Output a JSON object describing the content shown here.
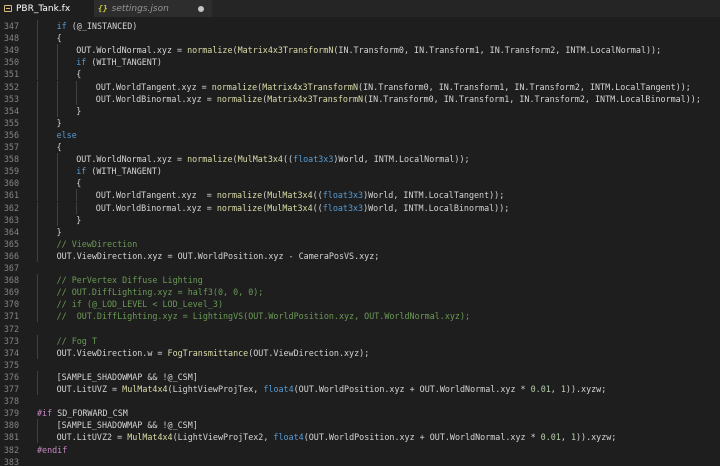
{
  "tabs": [
    {
      "label": "PBR_Tank.fx",
      "icon": "fx-file-icon",
      "active": true,
      "dirty": false
    },
    {
      "label": "settings.json",
      "icon": "json-file-icon",
      "active": false,
      "dirty": true
    }
  ],
  "lines": [
    {
      "n": "347",
      "indent": 1,
      "tokens": [
        [
          "kw",
          "if"
        ],
        [
          "id",
          " (@_INSTANCED)"
        ]
      ]
    },
    {
      "n": "348",
      "indent": 1,
      "tokens": [
        [
          "id",
          "{"
        ]
      ]
    },
    {
      "n": "349",
      "indent": 2,
      "tokens": [
        [
          "id",
          "OUT.WorldNormal.xyz = "
        ],
        [
          "fn",
          "normalize"
        ],
        [
          "id",
          "("
        ],
        [
          "fn",
          "Matrix4x3TransformN"
        ],
        [
          "id",
          "(IN.Transform0, IN.Transform1, IN.Transform2, INTM.LocalNormal));"
        ]
      ]
    },
    {
      "n": "350",
      "indent": 2,
      "tokens": [
        [
          "kw",
          "if"
        ],
        [
          "id",
          " (WITH_TANGENT)"
        ]
      ]
    },
    {
      "n": "351",
      "indent": 2,
      "tokens": [
        [
          "id",
          "{"
        ]
      ]
    },
    {
      "n": "352",
      "indent": 3,
      "tokens": [
        [
          "id",
          "OUT.WorldTangent.xyz = "
        ],
        [
          "fn",
          "normalize"
        ],
        [
          "id",
          "("
        ],
        [
          "fn",
          "Matrix4x3TransformN"
        ],
        [
          "id",
          "(IN.Transform0, IN.Transform1, IN.Transform2, INTM.LocalTangent));"
        ]
      ]
    },
    {
      "n": "353",
      "indent": 3,
      "tokens": [
        [
          "id",
          "OUT.WorldBinormal.xyz = "
        ],
        [
          "fn",
          "normalize"
        ],
        [
          "id",
          "("
        ],
        [
          "fn",
          "Matrix4x3TransformN"
        ],
        [
          "id",
          "(IN.Transform0, IN.Transform1, IN.Transform2, INTM.LocalBinormal));"
        ]
      ]
    },
    {
      "n": "354",
      "indent": 2,
      "tokens": [
        [
          "id",
          "}"
        ]
      ]
    },
    {
      "n": "355",
      "indent": 1,
      "tokens": [
        [
          "id",
          "}"
        ]
      ]
    },
    {
      "n": "356",
      "indent": 1,
      "tokens": [
        [
          "kw",
          "else"
        ]
      ]
    },
    {
      "n": "357",
      "indent": 1,
      "tokens": [
        [
          "id",
          "{"
        ]
      ]
    },
    {
      "n": "358",
      "indent": 2,
      "tokens": [
        [
          "id",
          "OUT.WorldNormal.xyz = "
        ],
        [
          "fn",
          "normalize"
        ],
        [
          "id",
          "("
        ],
        [
          "fn",
          "MulMat3x4"
        ],
        [
          "id",
          "(("
        ],
        [
          "ty",
          "float3x3"
        ],
        [
          "id",
          ")World, INTM.LocalNormal));"
        ]
      ]
    },
    {
      "n": "359",
      "indent": 2,
      "tokens": [
        [
          "kw",
          "if"
        ],
        [
          "id",
          " (WITH_TANGENT)"
        ]
      ]
    },
    {
      "n": "360",
      "indent": 2,
      "tokens": [
        [
          "id",
          "{"
        ]
      ]
    },
    {
      "n": "361",
      "indent": 3,
      "tokens": [
        [
          "id",
          "OUT.WorldTangent.xyz  = "
        ],
        [
          "fn",
          "normalize"
        ],
        [
          "id",
          "("
        ],
        [
          "fn",
          "MulMat3x4"
        ],
        [
          "id",
          "(("
        ],
        [
          "ty",
          "float3x3"
        ],
        [
          "id",
          ")World, INTM.LocalTangent));"
        ]
      ]
    },
    {
      "n": "362",
      "indent": 3,
      "tokens": [
        [
          "id",
          "OUT.WorldBinormal.xyz = "
        ],
        [
          "fn",
          "normalize"
        ],
        [
          "id",
          "("
        ],
        [
          "fn",
          "MulMat3x4"
        ],
        [
          "id",
          "(("
        ],
        [
          "ty",
          "float3x3"
        ],
        [
          "id",
          ")World, INTM.LocalBinormal));"
        ]
      ]
    },
    {
      "n": "363",
      "indent": 2,
      "tokens": [
        [
          "id",
          "}"
        ]
      ]
    },
    {
      "n": "364",
      "indent": 1,
      "tokens": [
        [
          "id",
          "}"
        ]
      ]
    },
    {
      "n": "365",
      "indent": 1,
      "tokens": [
        [
          "cm",
          "// ViewDirection"
        ]
      ]
    },
    {
      "n": "366",
      "indent": 1,
      "tokens": [
        [
          "id",
          "OUT.ViewDirection.xyz = OUT.WorldPosition.xyz - CameraPosVS.xyz;"
        ]
      ]
    },
    {
      "n": "367",
      "indent": 0,
      "tokens": []
    },
    {
      "n": "368",
      "indent": 1,
      "tokens": [
        [
          "cm",
          "// PerVertex Diffuse Lighting"
        ]
      ]
    },
    {
      "n": "369",
      "indent": 1,
      "tokens": [
        [
          "cm",
          "// OUT.DiffLighting.xyz = half3(0, 0, 0);"
        ]
      ]
    },
    {
      "n": "370",
      "indent": 1,
      "tokens": [
        [
          "cm",
          "// if (@_LOD_LEVEL < LOD_Level_3)"
        ]
      ]
    },
    {
      "n": "371",
      "indent": 1,
      "tokens": [
        [
          "cm",
          "//  OUT.DiffLighting.xyz = LightingVS(OUT.WorldPosition.xyz, OUT.WorldNormal.xyz);"
        ]
      ]
    },
    {
      "n": "372",
      "indent": 0,
      "tokens": []
    },
    {
      "n": "373",
      "indent": 1,
      "tokens": [
        [
          "cm",
          "// Fog T"
        ]
      ]
    },
    {
      "n": "374",
      "indent": 1,
      "tokens": [
        [
          "id",
          "OUT.ViewDirection.w = "
        ],
        [
          "fn",
          "FogTransmittance"
        ],
        [
          "id",
          "(OUT.ViewDirection.xyz);"
        ]
      ]
    },
    {
      "n": "375",
      "indent": 0,
      "tokens": []
    },
    {
      "n": "376",
      "indent": 1,
      "tokens": [
        [
          "id",
          "[SAMPLE_SHADOWMAP && !@_CSM]"
        ]
      ]
    },
    {
      "n": "377",
      "indent": 1,
      "tokens": [
        [
          "id",
          "OUT.LitUVZ = "
        ],
        [
          "fn",
          "MulMat4x4"
        ],
        [
          "id",
          "(LightViewProjTex, "
        ],
        [
          "ty",
          "float4"
        ],
        [
          "id",
          "(OUT.WorldPosition.xyz + OUT.WorldNormal.xyz * "
        ],
        [
          "num",
          "0.01"
        ],
        [
          "id",
          ", "
        ],
        [
          "num",
          "1"
        ],
        [
          "id",
          ")).xyzw;"
        ]
      ]
    },
    {
      "n": "378",
      "indent": 0,
      "tokens": []
    },
    {
      "n": "379",
      "indent": 0,
      "tokens": [
        [
          "pp",
          "#if"
        ],
        [
          "id",
          " SD_FORWARD_CSM"
        ]
      ]
    },
    {
      "n": "380",
      "indent": 1,
      "tokens": [
        [
          "id",
          "[SAMPLE_SHADOWMAP && !@_CSM]"
        ]
      ]
    },
    {
      "n": "381",
      "indent": 1,
      "tokens": [
        [
          "id",
          "OUT.LitUVZ2 = "
        ],
        [
          "fn",
          "MulMat4x4"
        ],
        [
          "id",
          "(LightViewProjTex2, "
        ],
        [
          "ty",
          "float4"
        ],
        [
          "id",
          "(OUT.WorldPosition.xyz + OUT.WorldNormal.xyz * "
        ],
        [
          "num",
          "0.01"
        ],
        [
          "id",
          ", "
        ],
        [
          "num",
          "1"
        ],
        [
          "id",
          ")).xyzw;"
        ]
      ]
    },
    {
      "n": "382",
      "indent": 0,
      "tokens": [
        [
          "pp",
          "#endif"
        ]
      ]
    },
    {
      "n": "383",
      "indent": 0,
      "tokens": []
    }
  ]
}
